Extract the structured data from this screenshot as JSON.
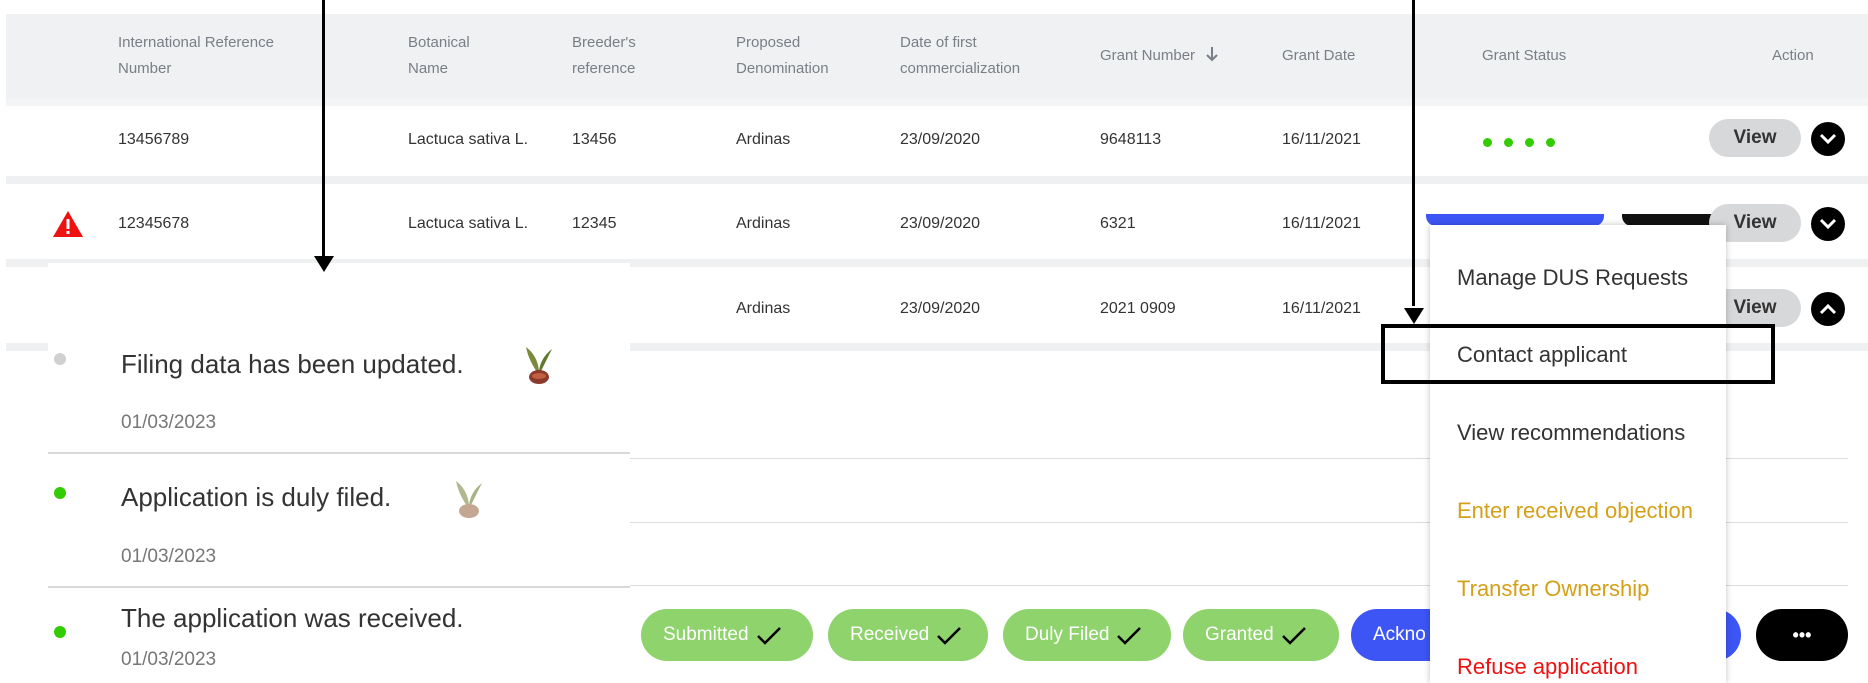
{
  "table": {
    "headers": [
      "International Reference Number",
      "Botanical Name",
      "Breeder's reference",
      "Proposed Denomination",
      "Date of first commercialization",
      "Grant Number",
      "Grant Date",
      "Grant Status",
      "Action"
    ],
    "rows": [
      {
        "ref": "13456789",
        "botanical": "Lactuca sativa L.",
        "breeder": "13456",
        "denomination": "Ardinas",
        "date": "23/09/2020",
        "grant_no": "9648113",
        "grant_date": "16/11/2021"
      },
      {
        "ref": "12345678",
        "botanical": "Lactuca sativa L.",
        "breeder": "12345",
        "denomination": "Ardinas",
        "date": "23/09/2020",
        "grant_no": "6321",
        "grant_date": "16/11/2021"
      },
      {
        "ref": "",
        "botanical": "",
        "breeder": "",
        "denomination": "Ardinas",
        "date": "23/09/2020",
        "grant_no": "2021 0909",
        "grant_date": "16/11/2021"
      }
    ],
    "view_label": "View"
  },
  "timeline": [
    {
      "title": "Filing data has been updated.",
      "date": "01/03/2023"
    },
    {
      "title": "Application is duly filed.",
      "date": "01/03/2023"
    },
    {
      "title": "The application was received.",
      "date": "01/03/2023"
    }
  ],
  "status_chips": [
    "Submitted",
    "Received",
    "Duly Filed",
    "Granted",
    "Ackno"
  ],
  "more_label": "•••",
  "menu": {
    "items": [
      {
        "label": "Manage DUS Requests",
        "color": "#333333"
      },
      {
        "label": "Contact applicant",
        "color": "#333333"
      },
      {
        "label": "View recommendations",
        "color": "#333333"
      },
      {
        "label": "Enter received objection",
        "color": "#d4a017"
      },
      {
        "label": "Transfer Ownership",
        "color": "#d4a017"
      },
      {
        "label": "Refuse application",
        "color": "#ee1111"
      }
    ]
  },
  "colors": {
    "chip_green": "#8ed36c",
    "accent_blue": "#3d55f5",
    "status_green": "#33cc00",
    "warning_red": "#ee1111"
  }
}
